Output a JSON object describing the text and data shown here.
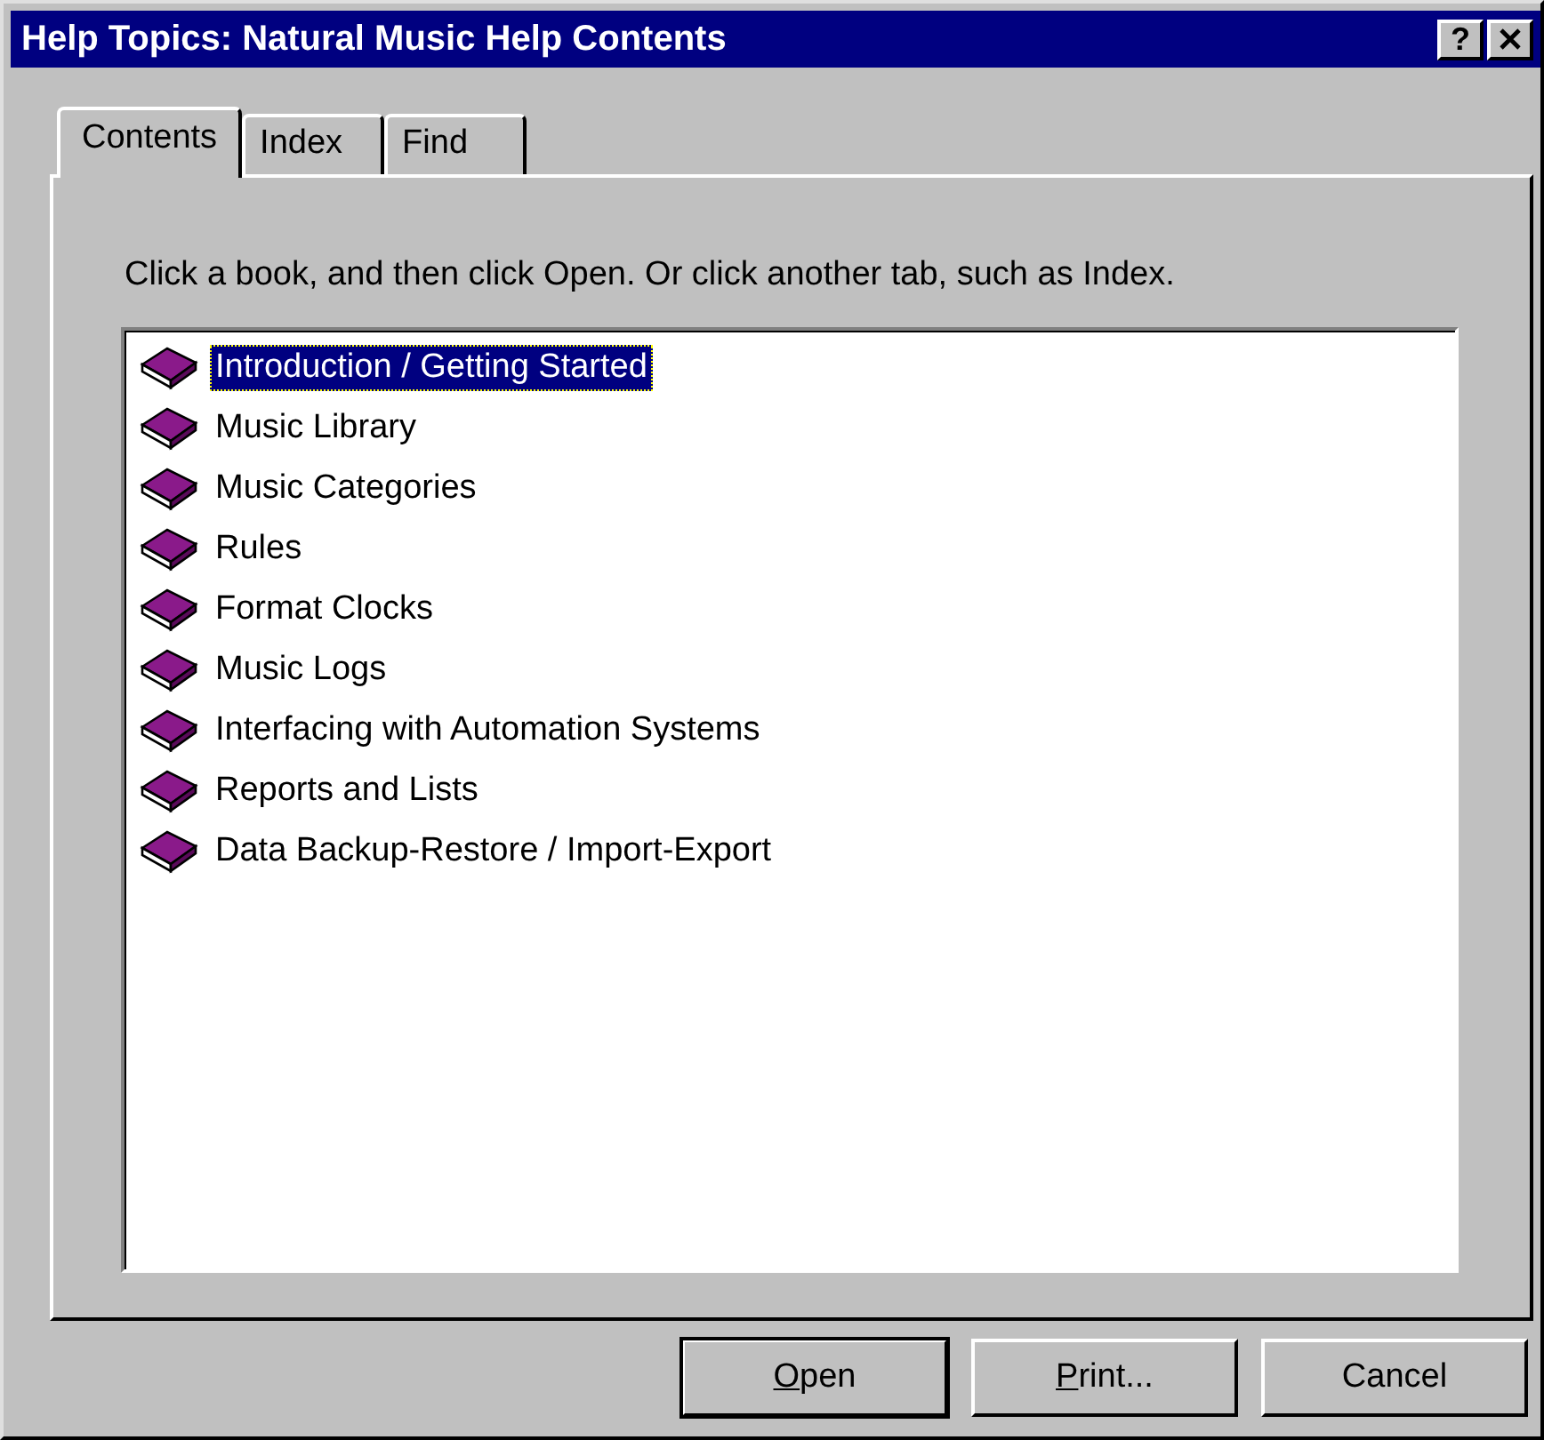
{
  "window": {
    "title": "Help Topics: Natural Music Help Contents",
    "help_button": "?"
  },
  "tabs": [
    {
      "label": "Contents",
      "selected": true
    },
    {
      "label": "Index",
      "selected": false
    },
    {
      "label": "Find",
      "selected": false
    }
  ],
  "instruction": "Click a book, and then click Open. Or click another tab, such as Index.",
  "books": [
    {
      "label": "Introduction / Getting Started",
      "selected": true
    },
    {
      "label": "Music Library",
      "selected": false
    },
    {
      "label": "Music Categories",
      "selected": false
    },
    {
      "label": "Rules",
      "selected": false
    },
    {
      "label": "Format Clocks",
      "selected": false
    },
    {
      "label": "Music Logs",
      "selected": false
    },
    {
      "label": "Interfacing with Automation Systems",
      "selected": false
    },
    {
      "label": "Reports and Lists",
      "selected": false
    },
    {
      "label": "Data Backup-Restore / Import-Export",
      "selected": false
    }
  ],
  "buttons": [
    {
      "label": "Open",
      "underline_first": true,
      "default": true
    },
    {
      "label": "Print...",
      "underline_first": true,
      "default": false
    },
    {
      "label": "Cancel",
      "underline_first": false,
      "default": false
    }
  ]
}
